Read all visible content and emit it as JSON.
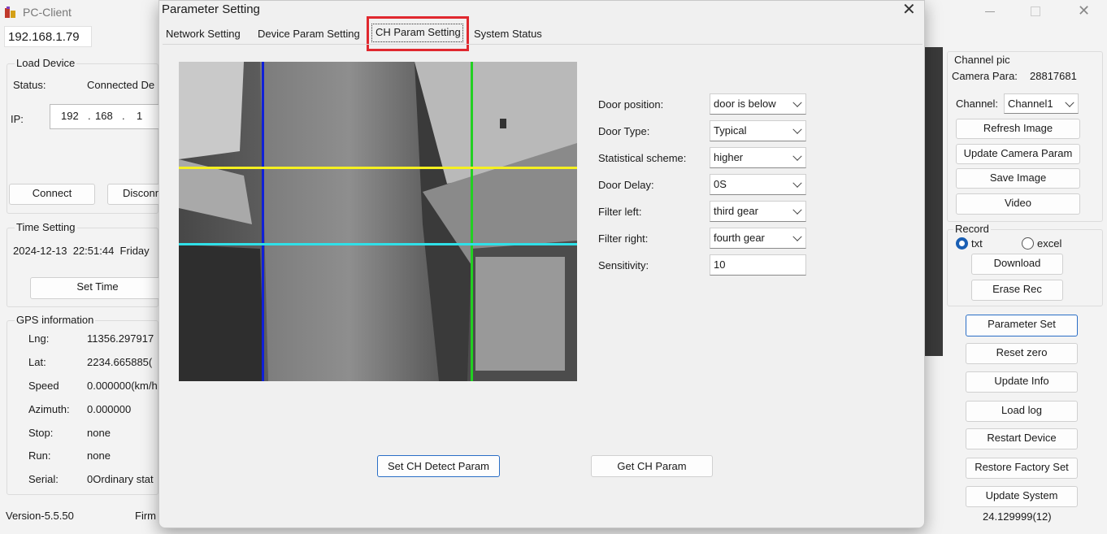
{
  "app": {
    "title": "PC-Client",
    "ip_display": "192.168.1.79",
    "version": "Version-5.5.50",
    "firmware_label": "Firm",
    "bottom_value": "24.129999(12)"
  },
  "load_device": {
    "title": "Load Device",
    "status_label": "Status:",
    "status_value": "Connected De",
    "ip_label": "IP:",
    "ip_parts": [
      "192",
      "168",
      "1"
    ],
    "connect_label": "Connect",
    "disconnect_label": "Disconn"
  },
  "time_setting": {
    "title": "Time Setting",
    "datetime": "2024-12-13  22:51:44  Friday",
    "set_time_label": "Set Time"
  },
  "gps": {
    "title": "GPS information",
    "rows": [
      {
        "label": "Lng:",
        "value": "11356.297917"
      },
      {
        "label": "Lat:",
        "value": "2234.665885("
      },
      {
        "label": "Speed",
        "value": "0.000000(km/h"
      },
      {
        "label": "Azimuth:",
        "value": "0.000000"
      },
      {
        "label": "Stop:",
        "value": "none"
      },
      {
        "label": "Run:",
        "value": "none"
      },
      {
        "label": "Serial:",
        "value": "0Ordinary stat"
      }
    ]
  },
  "right_panel": {
    "channel_pic_title": "Channel pic",
    "camera_para_label": "Camera Para:",
    "camera_para_value": "28817681",
    "channel_label": "Channel:",
    "channel_value": "Channel1",
    "refresh_image": "Refresh Image",
    "update_camera_param": "Update Camera Param",
    "save_image": "Save Image",
    "video": "Video",
    "record_title": "Record",
    "radio_txt": "txt",
    "radio_excel": "excel",
    "download": "Download",
    "erase_rec": "Erase Rec",
    "parameter_set": "Parameter Set",
    "reset_zero": "Reset zero",
    "update_info": "Update Info",
    "load_log": "Load log",
    "restart_device": "Restart Device",
    "restore_factory_set": "Restore Factory Set",
    "update_system": "Update System"
  },
  "dialog": {
    "title": "Parameter Setting",
    "tabs": [
      "Network Setting",
      "Device Param Setting",
      "CH Param Setting",
      "System Status"
    ],
    "active_tab": "CH Param Setting",
    "fields": [
      {
        "label": "Door position:",
        "value": "door is below"
      },
      {
        "label": "Door Type:",
        "value": "Typical"
      },
      {
        "label": "Statistical scheme:",
        "value": "higher"
      },
      {
        "label": "Door Delay:",
        "value": "0S"
      },
      {
        "label": "Filter left:",
        "value": "third gear"
      },
      {
        "label": "Filter right:",
        "value": "fourth gear"
      }
    ],
    "sensitivity_label": "Sensitivity:",
    "sensitivity_value": "10",
    "set_ch_detect_param": "Set CH Detect Param",
    "get_ch_param": "Get CH Param"
  },
  "colors": {
    "highlight_red": "#e0282e",
    "line_blue": "#1020d8",
    "line_green": "#22d022",
    "line_yellow": "#f5f020",
    "line_cyan": "#30e0e8",
    "accent_blue": "#2a6ec6"
  }
}
